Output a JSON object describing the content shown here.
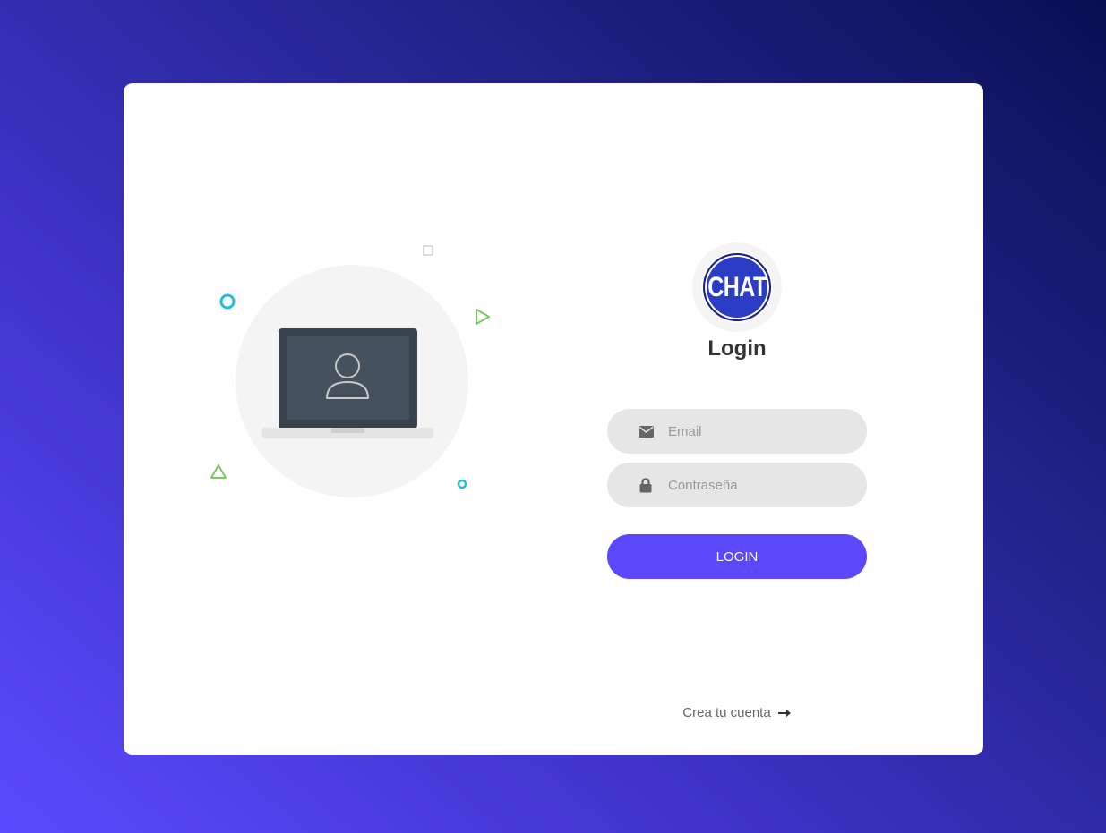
{
  "login": {
    "logo_text": "CHAT",
    "title": "Login",
    "email": {
      "placeholder": "Email",
      "value": "",
      "icon": "envelope-icon"
    },
    "password": {
      "placeholder": "Contraseña",
      "value": "",
      "icon": "lock-icon"
    },
    "submit_label": "LOGIN",
    "create_account_label": "Crea tu cuenta",
    "create_account_icon": "arrow-right-icon"
  },
  "illustration": {
    "icon": "laptop-user-icon"
  },
  "colors": {
    "accent": "#5a48fa",
    "background_start": "#5b4bff",
    "background_end": "#0a0f52",
    "logo_blue": "#2a3dc4",
    "deco_cyan": "#1ec0d8",
    "deco_green": "#7ac860"
  }
}
